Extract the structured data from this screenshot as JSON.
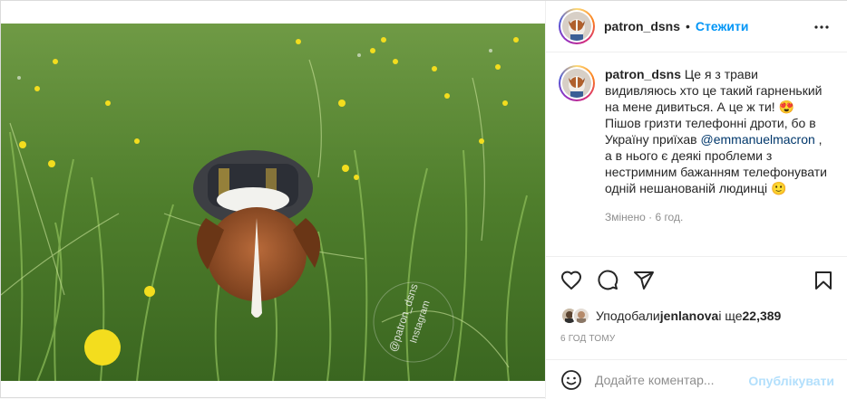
{
  "post": {
    "author": {
      "username": "patron_dsns",
      "follow_label": "Стежити",
      "dot": "•"
    },
    "image": {
      "watermark_handle": "@patron_dsns",
      "watermark_platform": "Instagram"
    },
    "caption": {
      "username": "patron_dsns",
      "text_part1": "Це я з трави видивляюсь хто це такий гарненький на мене дивиться. А це ж ти! 😍 Пішов гризти телефонні дроти, бо в Україну приїхав ",
      "mention": "@emmanuelmacron",
      "text_part2": " , а в нього є деякі проблеми з нестримним бажанням телефонувати одній нешанованій людинці 🙂",
      "edited": "Змінено",
      "edited_sep": " · ",
      "edited_time": "6 год."
    },
    "actions": [
      "like-icon",
      "comment-icon",
      "share-icon",
      "save-icon"
    ],
    "likes": {
      "prefix": "Уподобали ",
      "user": "jenlanova",
      "middle": " і ще ",
      "count": "22,389"
    },
    "timestamp": "6 ГОД ТОМУ",
    "comment": {
      "placeholder": "Додайте коментар...",
      "publish_label": "Опублікувати"
    }
  },
  "colors": {
    "accent": "#0095f6",
    "publish_disabled": "#b2dffc",
    "mention": "#00376b",
    "muted": "#8e8e8e"
  }
}
